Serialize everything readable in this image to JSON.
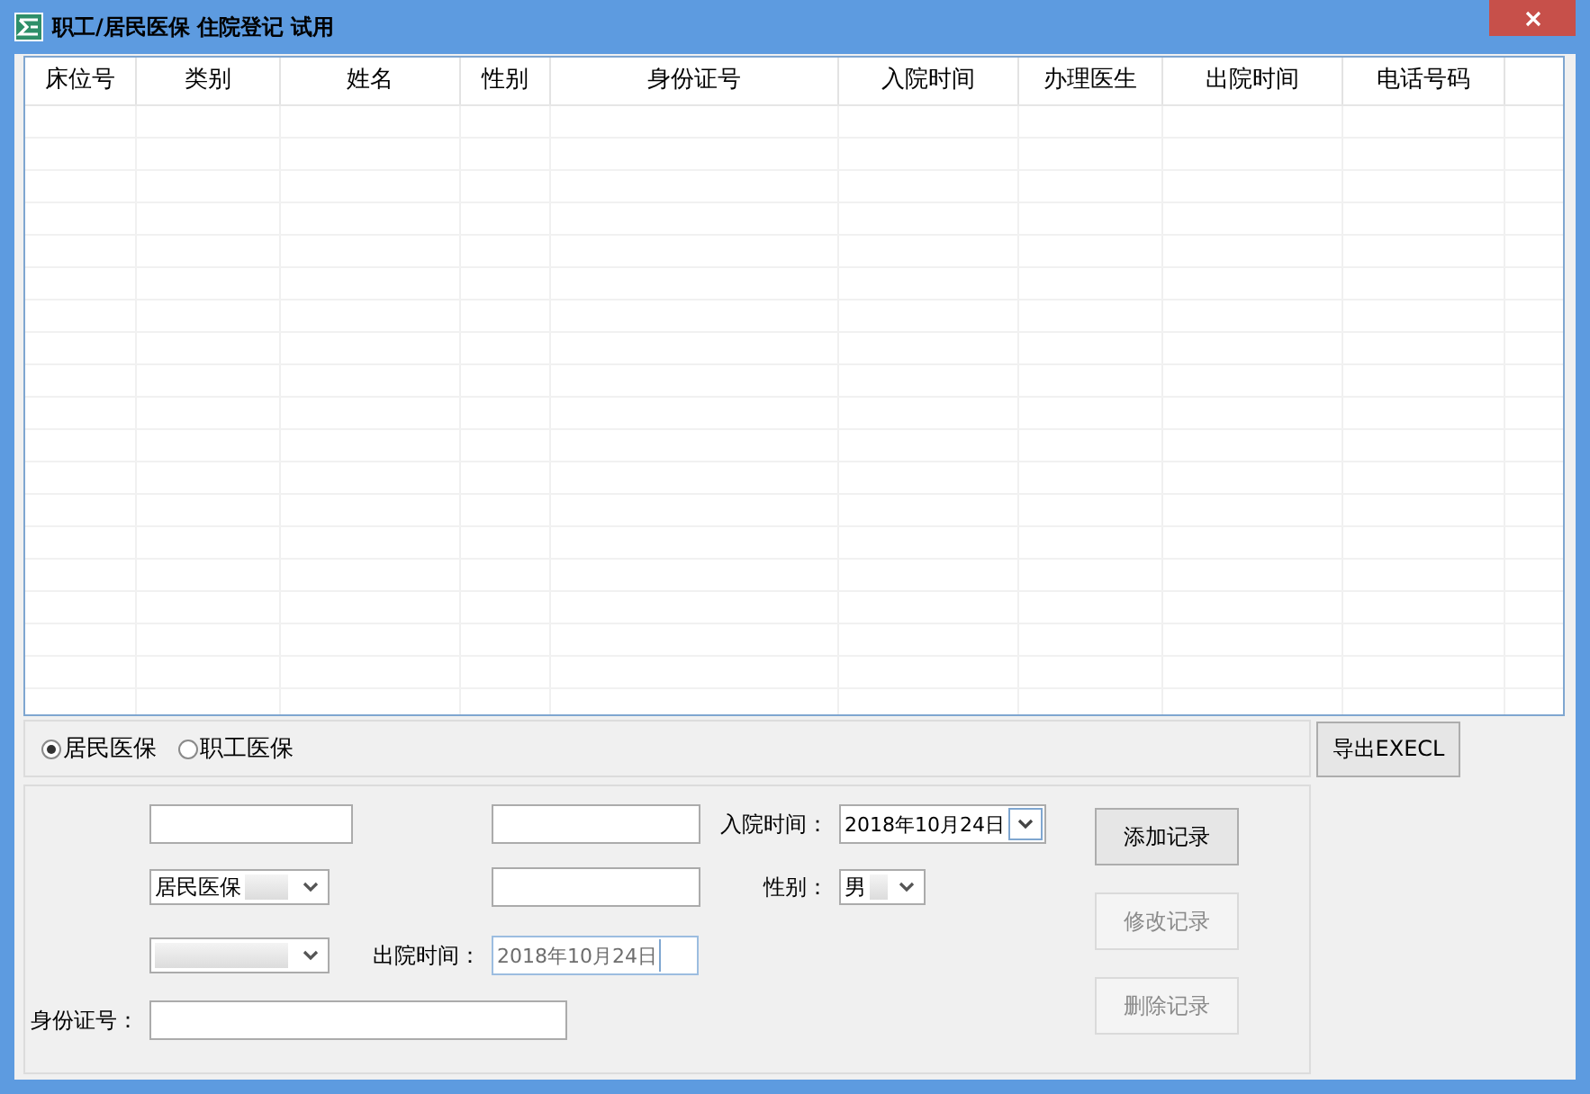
{
  "window": {
    "title": "职工/居民医保 住院登记 试用"
  },
  "table": {
    "columns": [
      "床位号",
      "类别",
      "姓名",
      "性别",
      "身份证号",
      "入院时间",
      "办理医生",
      "出院时间",
      "电话号码"
    ]
  },
  "insurance_type": [
    {
      "label": "居民医保",
      "selected": true
    },
    {
      "label": "职工医保",
      "selected": false
    }
  ],
  "export_button": {
    "label": "导出EXECL"
  },
  "form": {
    "category_select": {
      "value": "居民医保"
    },
    "admit_time": {
      "label": "入院时间：",
      "value": "2018年10月24日",
      "disabled": false
    },
    "gender": {
      "label": "性别：",
      "value": "男"
    },
    "discharge_time": {
      "label": "出院时间：",
      "value": "2018年10月24日",
      "disabled": true
    },
    "id_number": {
      "label": "身份证号："
    },
    "buttons": [
      {
        "label": "添加记录",
        "disabled": false
      },
      {
        "label": "修改记录",
        "disabled": true
      },
      {
        "label": "删除记录",
        "disabled": true
      }
    ]
  }
}
